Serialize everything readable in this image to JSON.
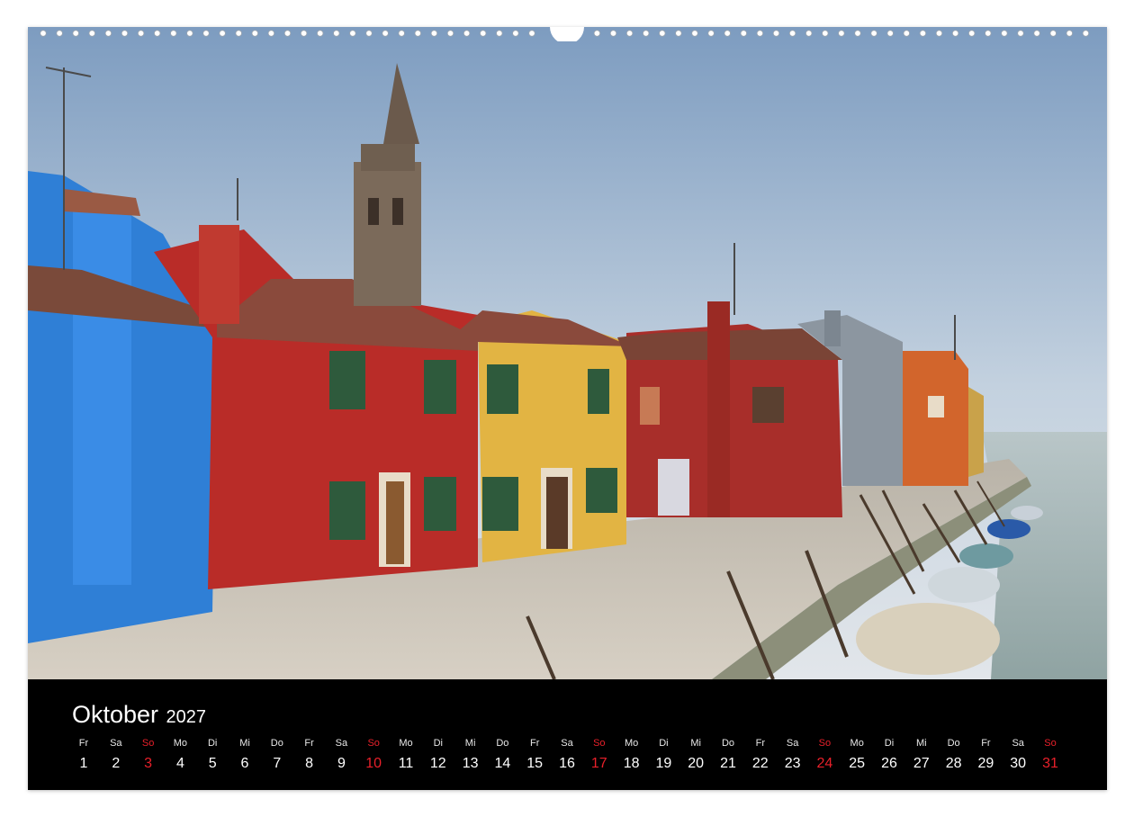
{
  "calendar": {
    "month": "Oktober",
    "year": "2027",
    "sunday_color": "#e8202a",
    "days": [
      {
        "wd": "Fr",
        "d": "1"
      },
      {
        "wd": "Sa",
        "d": "2"
      },
      {
        "wd": "So",
        "d": "3"
      },
      {
        "wd": "Mo",
        "d": "4"
      },
      {
        "wd": "Di",
        "d": "5"
      },
      {
        "wd": "Mi",
        "d": "6"
      },
      {
        "wd": "Do",
        "d": "7"
      },
      {
        "wd": "Fr",
        "d": "8"
      },
      {
        "wd": "Sa",
        "d": "9"
      },
      {
        "wd": "So",
        "d": "10"
      },
      {
        "wd": "Mo",
        "d": "11"
      },
      {
        "wd": "Di",
        "d": "12"
      },
      {
        "wd": "Mi",
        "d": "13"
      },
      {
        "wd": "Do",
        "d": "14"
      },
      {
        "wd": "Fr",
        "d": "15"
      },
      {
        "wd": "Sa",
        "d": "16"
      },
      {
        "wd": "So",
        "d": "17"
      },
      {
        "wd": "Mo",
        "d": "18"
      },
      {
        "wd": "Di",
        "d": "19"
      },
      {
        "wd": "Mi",
        "d": "20"
      },
      {
        "wd": "Do",
        "d": "21"
      },
      {
        "wd": "Fr",
        "d": "22"
      },
      {
        "wd": "Sa",
        "d": "23"
      },
      {
        "wd": "So",
        "d": "24"
      },
      {
        "wd": "Mo",
        "d": "25"
      },
      {
        "wd": "Di",
        "d": "26"
      },
      {
        "wd": "Mi",
        "d": "27"
      },
      {
        "wd": "Do",
        "d": "28"
      },
      {
        "wd": "Fr",
        "d": "29"
      },
      {
        "wd": "Sa",
        "d": "30"
      },
      {
        "wd": "So",
        "d": "31"
      }
    ]
  }
}
